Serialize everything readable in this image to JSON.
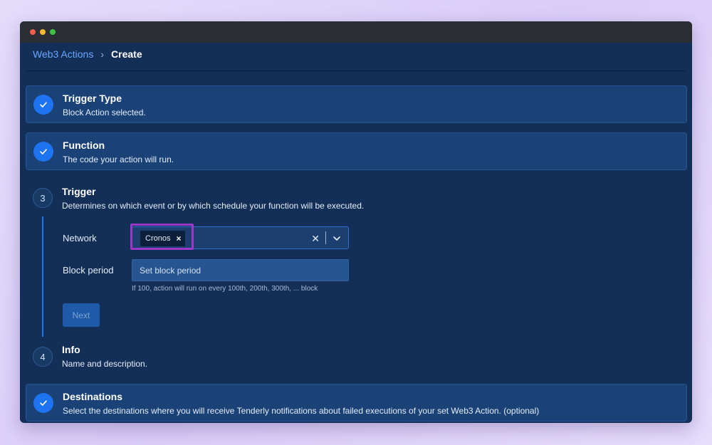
{
  "breadcrumb": {
    "parent": "Web3 Actions",
    "separator": "›",
    "current": "Create"
  },
  "steps": [
    {
      "title": "Trigger Type",
      "description": "Block Action selected.",
      "status": "done"
    },
    {
      "title": "Function",
      "description": "The code your action will run.",
      "status": "done"
    },
    {
      "number": "3",
      "title": "Trigger",
      "description": "Determines on which event or by which schedule your function will be executed.",
      "status": "active"
    },
    {
      "number": "4",
      "title": "Info",
      "description": "Name and description.",
      "status": "pending"
    },
    {
      "title": "Destinations",
      "description": "Select the destinations where you will receive Tenderly notifications about failed executions of your set Web3 Action. (optional)",
      "status": "done"
    }
  ],
  "trigger_form": {
    "network_label": "Network",
    "network_selected": "Cronos",
    "chip_remove": "×",
    "clear_icon": "✕",
    "block_period_label": "Block period",
    "block_period_placeholder": "Set block period",
    "block_period_hint": "If 100, action will run on every 100th, 200th, 300th, ... block",
    "next_label": "Next"
  },
  "icons": {
    "check": "check-icon",
    "clear": "close-icon",
    "chevron": "chevron-down-icon"
  },
  "colors": {
    "accent": "#1e73f0",
    "focus": "#9b38c9",
    "link": "#6aa6ff"
  }
}
